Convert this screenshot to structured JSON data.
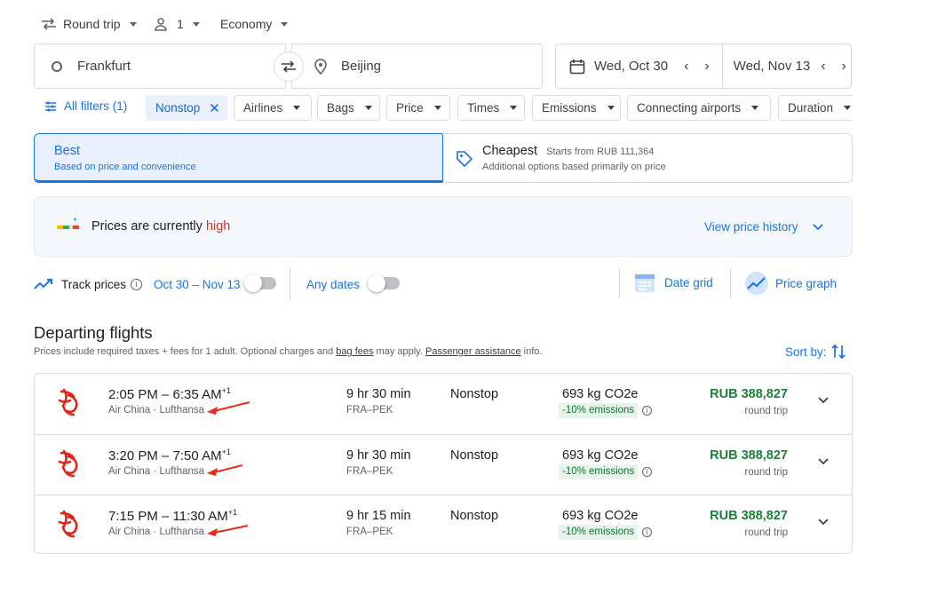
{
  "trip": {
    "type_label": "Round trip",
    "passengers": "1",
    "cabin": "Economy"
  },
  "search": {
    "origin": "Frankfurt",
    "destination": "Beijing",
    "depart_date": "Wed, Oct 30",
    "return_date": "Wed, Nov 13"
  },
  "filters": {
    "all_filters": "All filters (1)",
    "chips": [
      "Nonstop",
      "Airlines",
      "Bags",
      "Price",
      "Times",
      "Emissions",
      "Connecting airports",
      "Duration"
    ]
  },
  "sort_tabs": {
    "best_title": "Best",
    "best_sub": "Based on price and convenience",
    "cheapest_title": "Cheapest",
    "cheapest_from": "Starts from RUB 111,364",
    "cheapest_sub": "Additional options based primarily on price"
  },
  "insight": {
    "text": "Prices are currently",
    "level": "high",
    "history_link": "View price history"
  },
  "tracking": {
    "track_label": "Track prices",
    "date_range": "Oct 30 – Nov 13",
    "any_dates": "Any dates",
    "date_grid": "Date grid",
    "price_graph": "Price graph"
  },
  "departing": {
    "title": "Departing flights",
    "note_1": "Prices include required taxes + fees for 1 adult. Optional charges and ",
    "bag_fees": "bag fees",
    "note_2": " may apply. ",
    "passenger_assistance": "Passenger assistance",
    "note_3": " info.",
    "sort_by": "Sort by:"
  },
  "flights": [
    {
      "time": "2:05 PM – 6:35 AM",
      "plus": "+1",
      "airlines": "Air China · Lufthansa",
      "duration": "9 hr 30 min",
      "route": "FRA–PEK",
      "stops": "Nonstop",
      "co2": "693 kg CO2e",
      "emissions": "-10% emissions",
      "price": "RUB 388,827",
      "price_note": "round trip"
    },
    {
      "time": "3:20 PM – 7:50 AM",
      "plus": "+1",
      "airlines": "Air China · Lufthansa",
      "duration": "9 hr 30 min",
      "route": "FRA–PEK",
      "stops": "Nonstop",
      "co2": "693 kg CO2e",
      "emissions": "-10% emissions",
      "price": "RUB 388,827",
      "price_note": "round trip"
    },
    {
      "time": "7:15 PM – 11:30 AM",
      "plus": "+1",
      "airlines": "Air China · Lufthansa",
      "duration": "9 hr 15 min",
      "route": "FRA–PEK",
      "stops": "Nonstop",
      "co2": "693 kg CO2e",
      "emissions": "-10% emissions",
      "price": "RUB 388,827",
      "price_note": "round trip"
    }
  ],
  "colors": {
    "accent": "#1a73e8",
    "price_green": "#188038",
    "high_red": "#d93025",
    "annotation_arrow": "#e8291c"
  }
}
